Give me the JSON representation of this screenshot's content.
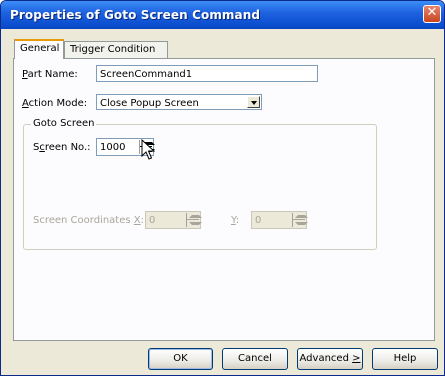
{
  "window": {
    "title": "Properties of Goto Screen Command"
  },
  "tabs": [
    {
      "label": "General"
    },
    {
      "label": "Trigger Condition"
    }
  ],
  "general": {
    "part_name": {
      "label_underlined": "P",
      "label_rest": "art Name:",
      "value": "ScreenCommand1"
    },
    "action_mode": {
      "label_underlined": "A",
      "label_rest": "ction Mode:",
      "value": "Close Popup Screen"
    },
    "goto_screen": {
      "group_label": "Goto Screen",
      "screen_no": {
        "label_pre": "S",
        "label_underlined": "c",
        "label_rest": "reen No.:",
        "value": "1000"
      },
      "coordinates": {
        "label_pre": "Screen Coordinates ",
        "label_underlined": "X",
        "label_rest": ":",
        "x_value": "0",
        "y_label_underlined": "Y",
        "y_label_rest": ":",
        "y_value": "0"
      }
    }
  },
  "buttons": {
    "ok": "OK",
    "cancel": "Cancel",
    "advanced_pre": "Advanced ",
    "advanced_underlined": ">",
    "help": "Help"
  },
  "icons": {
    "close": "close-icon",
    "cursor": "mouse-pointer-icon"
  }
}
